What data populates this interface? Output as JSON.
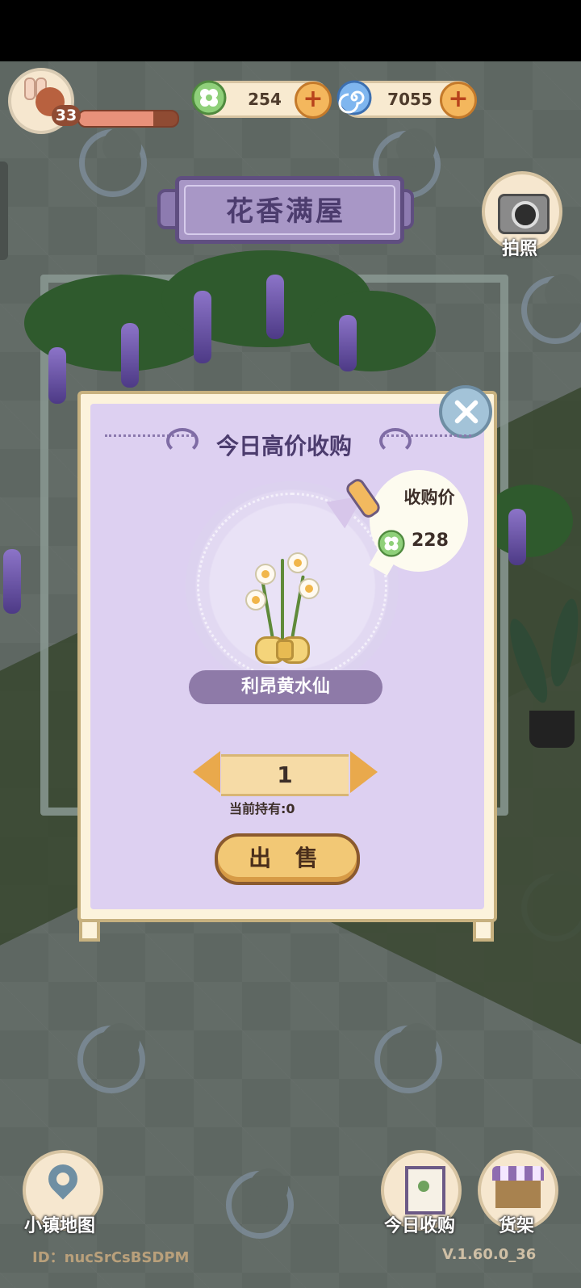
{
  "hud": {
    "level": "33",
    "xp_fraction": 0.75,
    "clover_currency": "254",
    "swirl_currency": "7055",
    "plus_symbol": "+"
  },
  "scene": {
    "title": "花香满屋",
    "camera_label": "拍照"
  },
  "dialog": {
    "title": "今日高价收购",
    "price_label": "收购价",
    "price_value": "228",
    "item_name": "利昂黄水仙",
    "quantity": "1",
    "holding_text": "当前持有:0",
    "sell_label": "出 售"
  },
  "bottom_nav": {
    "map_label": "小镇地图",
    "purchase_label": "今日收购",
    "shelf_label": "货架"
  },
  "footer": {
    "id_text": "ID：nucSrCsBSDPM",
    "version_text": "V.1.60.0_36"
  },
  "colors": {
    "dialog_bg": "#ddd0f1",
    "title_purple": "#4c3c6e",
    "sell_button": "#f2c875",
    "clover_green": "#7fbf6a",
    "swirl_blue": "#6aa6e8"
  },
  "icons": [
    "avatar-snail-icon",
    "clover-coin-icon",
    "swirl-coin-icon",
    "plus-icon",
    "camera-icon",
    "close-icon",
    "megaphone-icon",
    "daffodil-bouquet-icon",
    "left-arrow-icon",
    "right-arrow-icon",
    "map-pin-icon",
    "sign-board-icon",
    "shop-stall-icon"
  ]
}
